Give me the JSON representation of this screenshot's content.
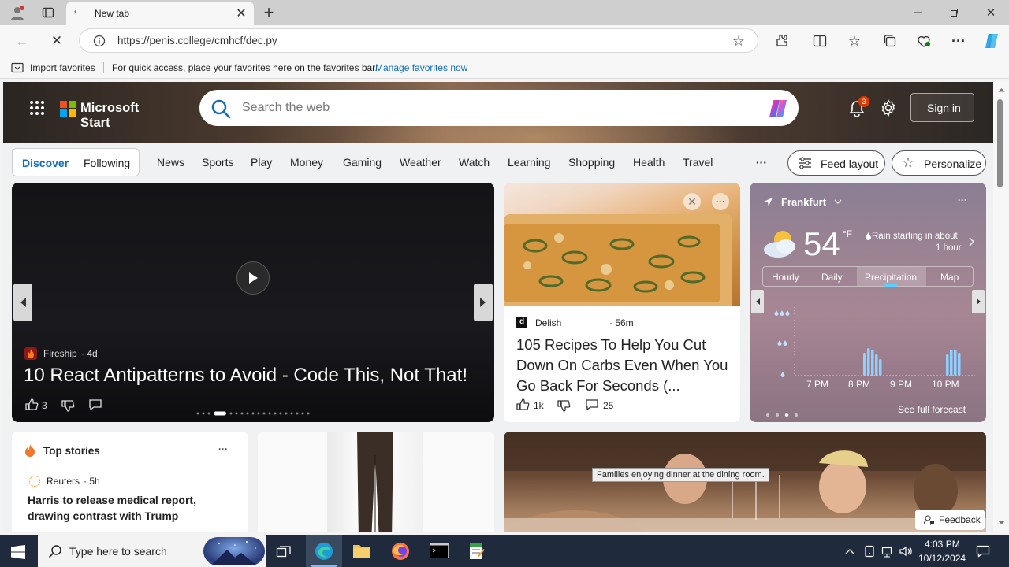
{
  "browser": {
    "tab_title": "New tab",
    "url": "https://penis.college/cmhcf/dec.py",
    "favorites_import": "Import favorites",
    "favorites_hint": "For quick access, place your favorites here on the favorites bar.",
    "favorites_link": "Manage favorites now"
  },
  "header": {
    "brand": "Microsoft Start",
    "search_placeholder": "Search the web",
    "notification_count": "3",
    "signin": "Sign in"
  },
  "nav": {
    "discover": "Discover",
    "following": "Following",
    "items": [
      "News",
      "Sports",
      "Play",
      "Money",
      "Gaming",
      "Weather",
      "Watch",
      "Learning",
      "Shopping",
      "Health",
      "Travel"
    ],
    "more": "···",
    "feed_layout": "Feed layout",
    "personalize": "Personalize"
  },
  "hero_card": {
    "source": "Fireship",
    "age": "· 4d",
    "title": "10 React Antipatterns to Avoid - Code This, Not That!",
    "likes": "3"
  },
  "recipe_card": {
    "source": "Delish",
    "age": "· 56m",
    "title": "105 Recipes To Help You Cut Down On Carbs Even When You Go Back For Seconds (...",
    "likes": "1k",
    "comments": "25"
  },
  "weather": {
    "city": "Frankfurt",
    "temp": "54",
    "unit": "°F",
    "note_line1": "Rain starting in about",
    "note_line2": "1 hour",
    "tabs": [
      "Hourly",
      "Daily",
      "Precipitation",
      "Map"
    ],
    "active_tab": "Precipitation",
    "times": [
      "7 PM",
      "8 PM",
      "9 PM",
      "10 PM"
    ],
    "forecast_link": "See full forecast"
  },
  "top_stories": {
    "title": "Top stories",
    "source": "Reuters",
    "age": "· 5h",
    "headline": "Harris to release medical report, drawing contrast with Trump"
  },
  "dining": {
    "caption": "Families enjoying dinner at the dining room."
  },
  "feedback": "Feedback",
  "taskbar": {
    "search_placeholder": "Type here to search",
    "time": "4:03 PM",
    "date": "10/12/2024"
  },
  "colors": {
    "accent": "#0f6cbd",
    "brand_red": "#f25022",
    "brand_green": "#7fba00",
    "brand_blue": "#00a4ef",
    "brand_yellow": "#ffb900"
  }
}
